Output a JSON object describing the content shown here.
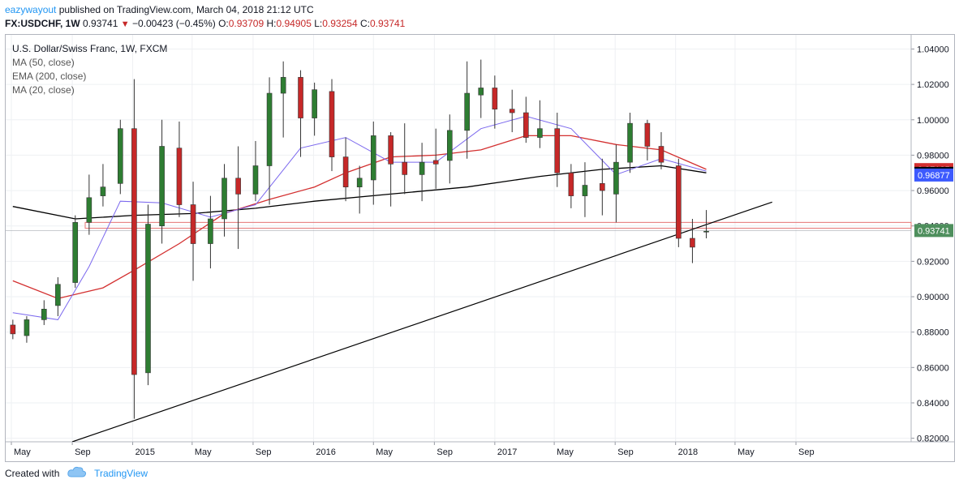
{
  "header": {
    "author": "eazywayout",
    "published_text": "published on TradingView.com, March 04, 2018 21:12 UTC"
  },
  "symbol_bar": {
    "symbol": "FX:USDCHF, 1W",
    "last": "0.93741",
    "change": "−0.00423 (−0.45%)",
    "open_label": "O:",
    "open": "0.93709",
    "high_label": "H:",
    "high": "0.94905",
    "low_label": "L:",
    "low": "0.93254",
    "close_label": "C:",
    "close": "0.93741"
  },
  "legend": {
    "title": "U.S. Dollar/Swiss Franc, 1W, FXCM",
    "ind1": "MA (50, close)",
    "ind2": "EMA (200, close)",
    "ind3": "MA (20, close)"
  },
  "footer": {
    "created_with": "Created with",
    "brand": "TradingView",
    "brand_icon": "cloud-icon"
  },
  "colors": {
    "up": "#2e7d32",
    "down": "#c62828",
    "ma50": "#d32f2f",
    "ema200": "#000000",
    "ma20": "#7b68ee",
    "axis_text": "#131722",
    "grid": "#eef0f3",
    "price_label_bg": "#4e8f5d"
  },
  "chart_data": {
    "type": "candlestick",
    "x_tick_labels": [
      "May",
      "Sep",
      "2015",
      "May",
      "Sep",
      "2016",
      "May",
      "Sep",
      "2017",
      "May",
      "Sep",
      "2018",
      "May",
      "Sep"
    ],
    "y_ticks": [
      0.82,
      0.84,
      0.86,
      0.88,
      0.9,
      0.92,
      0.94,
      0.96,
      0.98,
      1.0,
      1.02,
      1.04
    ],
    "y_tick_labels": [
      "0.82000",
      "0.84000",
      "0.86000",
      "0.88000",
      "0.90000",
      "0.92000",
      "0.94000",
      "0.96000",
      "0.98000",
      "1.00000",
      "1.02000",
      "1.04000"
    ],
    "ylim": [
      0.818,
      1.048
    ],
    "axis_price_labels": [
      {
        "value": 0.97185,
        "text": "0.97185",
        "color": "#d32f2f"
      },
      {
        "value": 0.96972,
        "text": "0.96972",
        "color": "#000000"
      },
      {
        "value": 0.96877,
        "text": "0.96877",
        "color": "#3d5afe"
      },
      {
        "value": 0.93741,
        "text": "0.93741",
        "color": "#4e8f5d"
      }
    ],
    "support_zone": {
      "from": 0.9387,
      "to": 0.942,
      "color": "#e57373"
    },
    "trendline": {
      "start": {
        "date": "2014-09-01",
        "value": 0.818
      },
      "end": {
        "date": "2018-07-15",
        "value": 0.9535
      }
    },
    "grid": true,
    "candles": [
      {
        "d": "2014-05-04",
        "o": 0.884,
        "h": 0.887,
        "l": 0.876,
        "c": 0.879
      },
      {
        "d": "2014-06-01",
        "o": 0.878,
        "h": 0.889,
        "l": 0.874,
        "c": 0.887
      },
      {
        "d": "2014-07-06",
        "o": 0.887,
        "h": 0.898,
        "l": 0.884,
        "c": 0.893
      },
      {
        "d": "2014-08-03",
        "o": 0.895,
        "h": 0.911,
        "l": 0.889,
        "c": 0.907
      },
      {
        "d": "2014-09-07",
        "o": 0.908,
        "h": 0.946,
        "l": 0.905,
        "c": 0.942
      },
      {
        "d": "2014-10-05",
        "o": 0.942,
        "h": 0.969,
        "l": 0.935,
        "c": 0.956
      },
      {
        "d": "2014-11-02",
        "o": 0.957,
        "h": 0.975,
        "l": 0.951,
        "c": 0.962
      },
      {
        "d": "2014-12-07",
        "o": 0.964,
        "h": 1.0,
        "l": 0.958,
        "c": 0.995
      },
      {
        "d": "2015-01-04",
        "o": 0.995,
        "h": 1.023,
        "l": 0.831,
        "c": 0.856
      },
      {
        "d": "2015-02-01",
        "o": 0.857,
        "h": 0.952,
        "l": 0.85,
        "c": 0.941
      },
      {
        "d": "2015-03-01",
        "o": 0.94,
        "h": 1.0,
        "l": 0.93,
        "c": 0.985
      },
      {
        "d": "2015-04-05",
        "o": 0.984,
        "h": 0.999,
        "l": 0.945,
        "c": 0.952
      },
      {
        "d": "2015-05-03",
        "o": 0.952,
        "h": 0.965,
        "l": 0.909,
        "c": 0.93
      },
      {
        "d": "2015-06-07",
        "o": 0.93,
        "h": 0.957,
        "l": 0.916,
        "c": 0.944
      },
      {
        "d": "2015-07-05",
        "o": 0.944,
        "h": 0.975,
        "l": 0.934,
        "c": 0.967
      },
      {
        "d": "2015-08-02",
        "o": 0.967,
        "h": 0.985,
        "l": 0.927,
        "c": 0.958
      },
      {
        "d": "2015-09-06",
        "o": 0.958,
        "h": 0.988,
        "l": 0.954,
        "c": 0.974
      },
      {
        "d": "2015-10-04",
        "o": 0.974,
        "h": 1.024,
        "l": 0.952,
        "c": 1.015
      },
      {
        "d": "2015-11-01",
        "o": 1.015,
        "h": 1.033,
        "l": 0.99,
        "c": 1.024
      },
      {
        "d": "2015-12-06",
        "o": 1.024,
        "h": 1.028,
        "l": 0.979,
        "c": 1.001
      },
      {
        "d": "2016-01-03",
        "o": 1.001,
        "h": 1.021,
        "l": 0.991,
        "c": 1.017
      },
      {
        "d": "2016-02-07",
        "o": 1.016,
        "h": 1.023,
        "l": 0.971,
        "c": 0.979
      },
      {
        "d": "2016-03-06",
        "o": 0.979,
        "h": 0.99,
        "l": 0.954,
        "c": 0.962
      },
      {
        "d": "2016-04-03",
        "o": 0.962,
        "h": 0.974,
        "l": 0.947,
        "c": 0.967
      },
      {
        "d": "2016-05-01",
        "o": 0.966,
        "h": 0.999,
        "l": 0.952,
        "c": 0.991
      },
      {
        "d": "2016-06-05",
        "o": 0.991,
        "h": 0.993,
        "l": 0.951,
        "c": 0.975
      },
      {
        "d": "2016-07-03",
        "o": 0.976,
        "h": 0.998,
        "l": 0.958,
        "c": 0.969
      },
      {
        "d": "2016-08-07",
        "o": 0.969,
        "h": 0.987,
        "l": 0.954,
        "c": 0.976
      },
      {
        "d": "2016-09-04",
        "o": 0.977,
        "h": 0.995,
        "l": 0.961,
        "c": 0.975
      },
      {
        "d": "2016-10-02",
        "o": 0.977,
        "h": 1.003,
        "l": 0.964,
        "c": 0.994
      },
      {
        "d": "2016-11-06",
        "o": 0.994,
        "h": 1.033,
        "l": 0.978,
        "c": 1.015
      },
      {
        "d": "2016-12-04",
        "o": 1.014,
        "h": 1.034,
        "l": 1.001,
        "c": 1.018
      },
      {
        "d": "2017-01-01",
        "o": 1.018,
        "h": 1.025,
        "l": 0.995,
        "c": 1.006
      },
      {
        "d": "2017-02-05",
        "o": 1.006,
        "h": 1.017,
        "l": 0.993,
        "c": 1.004
      },
      {
        "d": "2017-03-05",
        "o": 1.004,
        "h": 1.013,
        "l": 0.987,
        "c": 0.99
      },
      {
        "d": "2017-04-02",
        "o": 0.99,
        "h": 1.011,
        "l": 0.984,
        "c": 0.995
      },
      {
        "d": "2017-05-07",
        "o": 0.995,
        "h": 1.004,
        "l": 0.962,
        "c": 0.97
      },
      {
        "d": "2017-06-04",
        "o": 0.97,
        "h": 0.975,
        "l": 0.95,
        "c": 0.957
      },
      {
        "d": "2017-07-02",
        "o": 0.957,
        "h": 0.976,
        "l": 0.945,
        "c": 0.963
      },
      {
        "d": "2017-08-06",
        "o": 0.964,
        "h": 0.978,
        "l": 0.946,
        "c": 0.96
      },
      {
        "d": "2017-09-03",
        "o": 0.958,
        "h": 0.986,
        "l": 0.942,
        "c": 0.976
      },
      {
        "d": "2017-10-01",
        "o": 0.976,
        "h": 1.004,
        "l": 0.97,
        "c": 0.998
      },
      {
        "d": "2017-11-05",
        "o": 0.998,
        "h": 1.0,
        "l": 0.977,
        "c": 0.985
      },
      {
        "d": "2017-12-03",
        "o": 0.985,
        "h": 0.993,
        "l": 0.972,
        "c": 0.976
      },
      {
        "d": "2018-01-07",
        "o": 0.974,
        "h": 0.978,
        "l": 0.928,
        "c": 0.933
      },
      {
        "d": "2018-02-04",
        "o": 0.933,
        "h": 0.944,
        "l": 0.919,
        "c": 0.928
      },
      {
        "d": "2018-03-04",
        "o": 0.937,
        "h": 0.949,
        "l": 0.933,
        "c": 0.937
      }
    ],
    "ma50": [
      {
        "d": "2014-05-04",
        "v": 0.909
      },
      {
        "d": "2014-08-03",
        "v": 0.899
      },
      {
        "d": "2014-11-02",
        "v": 0.905
      },
      {
        "d": "2015-01-04",
        "v": 0.915
      },
      {
        "d": "2015-04-05",
        "v": 0.93
      },
      {
        "d": "2015-07-05",
        "v": 0.947
      },
      {
        "d": "2015-10-04",
        "v": 0.955
      },
      {
        "d": "2016-01-03",
        "v": 0.962
      },
      {
        "d": "2016-03-06",
        "v": 0.97
      },
      {
        "d": "2016-06-05",
        "v": 0.979
      },
      {
        "d": "2016-09-04",
        "v": 0.98
      },
      {
        "d": "2016-12-04",
        "v": 0.983
      },
      {
        "d": "2017-03-05",
        "v": 0.991
      },
      {
        "d": "2017-06-04",
        "v": 0.991
      },
      {
        "d": "2017-09-03",
        "v": 0.986
      },
      {
        "d": "2017-12-03",
        "v": 0.983
      },
      {
        "d": "2018-03-04",
        "v": 0.972
      }
    ],
    "ema200": [
      {
        "d": "2014-05-04",
        "v": 0.951
      },
      {
        "d": "2014-09-07",
        "v": 0.944
      },
      {
        "d": "2015-01-04",
        "v": 0.946
      },
      {
        "d": "2015-05-03",
        "v": 0.947
      },
      {
        "d": "2015-09-06",
        "v": 0.95
      },
      {
        "d": "2016-01-03",
        "v": 0.954
      },
      {
        "d": "2016-06-05",
        "v": 0.958
      },
      {
        "d": "2016-11-06",
        "v": 0.962
      },
      {
        "d": "2017-04-02",
        "v": 0.968
      },
      {
        "d": "2017-08-06",
        "v": 0.972
      },
      {
        "d": "2017-12-03",
        "v": 0.974
      },
      {
        "d": "2018-03-04",
        "v": 0.97
      }
    ],
    "ma20": [
      {
        "d": "2014-05-04",
        "v": 0.891
      },
      {
        "d": "2014-08-03",
        "v": 0.887
      },
      {
        "d": "2014-10-05",
        "v": 0.917
      },
      {
        "d": "2014-12-07",
        "v": 0.954
      },
      {
        "d": "2015-03-01",
        "v": 0.953
      },
      {
        "d": "2015-06-07",
        "v": 0.945
      },
      {
        "d": "2015-09-06",
        "v": 0.952
      },
      {
        "d": "2015-12-06",
        "v": 0.984
      },
      {
        "d": "2016-03-06",
        "v": 0.99
      },
      {
        "d": "2016-06-05",
        "v": 0.976
      },
      {
        "d": "2016-09-04",
        "v": 0.976
      },
      {
        "d": "2016-12-04",
        "v": 0.995
      },
      {
        "d": "2017-03-05",
        "v": 1.002
      },
      {
        "d": "2017-06-04",
        "v": 0.995
      },
      {
        "d": "2017-09-03",
        "v": 0.969
      },
      {
        "d": "2017-12-03",
        "v": 0.978
      },
      {
        "d": "2018-03-04",
        "v": 0.971
      }
    ]
  }
}
